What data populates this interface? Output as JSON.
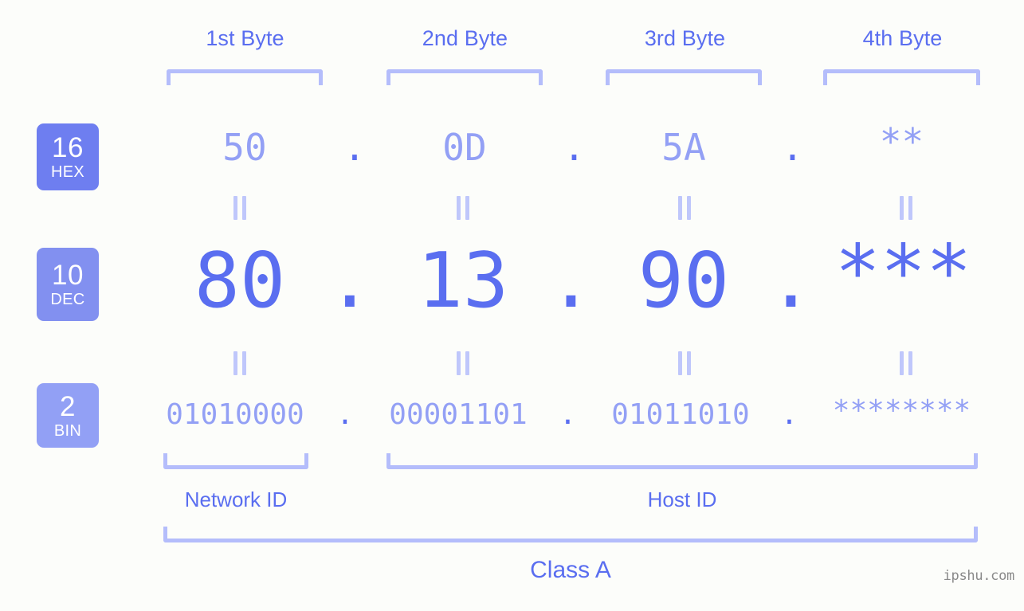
{
  "background_color": "#fcfdfa",
  "accent_strong": "#5a6ef0",
  "accent_light": "#93a0f5",
  "bracket_color": "#b4bdfb",
  "byte_headers": [
    {
      "label": "1st Byte"
    },
    {
      "label": "2nd Byte"
    },
    {
      "label": "3rd Byte"
    },
    {
      "label": "4th Byte"
    }
  ],
  "bases": [
    {
      "num": "16",
      "name": "HEX",
      "color": "#6e7ef0"
    },
    {
      "num": "10",
      "name": "DEC",
      "color": "#8290f0"
    },
    {
      "num": "2",
      "name": "BIN",
      "color": "#92a0f5"
    }
  ],
  "rows": {
    "hex": {
      "base_num": "16",
      "base_name": "HEX",
      "values": [
        "50",
        "0D",
        "5A",
        "**"
      ],
      "separator": "."
    },
    "dec": {
      "base_num": "10",
      "base_name": "DEC",
      "values": [
        "80",
        "13",
        "90",
        "***"
      ],
      "separator": "."
    },
    "bin": {
      "base_num": "2",
      "base_name": "BIN",
      "values": [
        "01010000",
        "00001101",
        "01011010",
        "********"
      ],
      "separator": "."
    }
  },
  "equivalence_symbol": "||",
  "segments": {
    "network_id": {
      "label": "Network ID"
    },
    "host_id": {
      "label": "Host ID"
    },
    "class": {
      "label": "Class A"
    }
  },
  "watermark": {
    "text": "ipshu.com"
  }
}
